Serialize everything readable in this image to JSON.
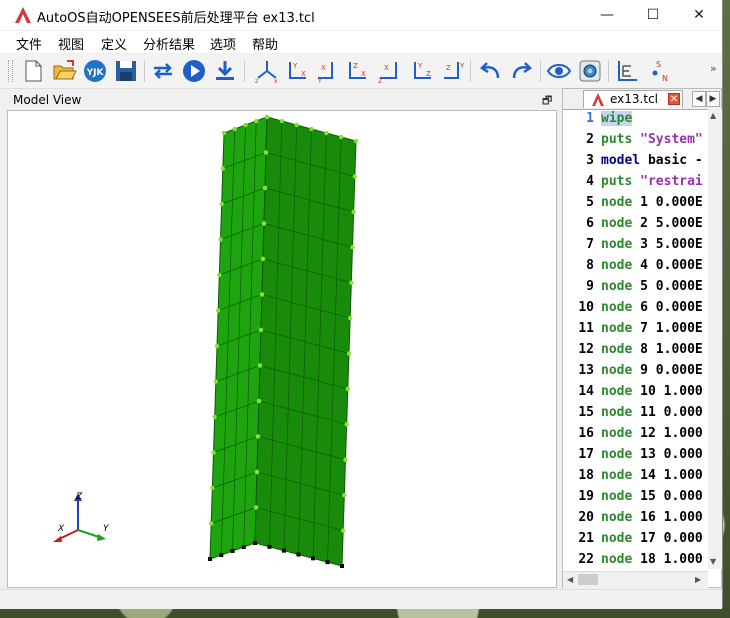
{
  "window": {
    "title": "AutoOS自动OPENSEES前后处理平台 ex13.tcl",
    "minimize": "—",
    "maximize": "☐",
    "close": "✕"
  },
  "menu": [
    {
      "label": "文件"
    },
    {
      "label": "视图"
    },
    {
      "label": "定义"
    },
    {
      "label": "分析结果"
    },
    {
      "label": "选项"
    },
    {
      "label": "帮助"
    }
  ],
  "toolbar": {
    "open_yjk_label": "YJK",
    "more_label": "»"
  },
  "model_view": {
    "title": "Model View",
    "restore": "🗗"
  },
  "axes_triad": {
    "x": "X",
    "y": "Y",
    "z": "Z"
  },
  "editor": {
    "tab_label": "ex13.tcl",
    "tab_close": "✕",
    "tab_prev": "◀",
    "tab_next": "▶",
    "scroll_up": "▲",
    "scroll_down": "▼",
    "scroll_left": "◀",
    "scroll_right": "▶",
    "lines": [
      {
        "num": "1",
        "kw": "wipe",
        "rest": ""
      },
      {
        "num": "2",
        "kw": "puts",
        "rest": " \"System\""
      },
      {
        "num": "3",
        "kw": "model",
        "rest": " basic -"
      },
      {
        "num": "4",
        "kw": "puts",
        "rest": " \"restrai"
      },
      {
        "num": "5",
        "kw": "node",
        "rest": " 1 0.000E"
      },
      {
        "num": "6",
        "kw": "node",
        "rest": " 2 5.000E"
      },
      {
        "num": "7",
        "kw": "node",
        "rest": " 3 5.000E"
      },
      {
        "num": "8",
        "kw": "node",
        "rest": " 4 0.000E"
      },
      {
        "num": "9",
        "kw": "node",
        "rest": " 5 0.000E"
      },
      {
        "num": "10",
        "kw": "node",
        "rest": " 6 0.000E"
      },
      {
        "num": "11",
        "kw": "node",
        "rest": " 7 1.000E"
      },
      {
        "num": "12",
        "kw": "node",
        "rest": " 8 1.000E"
      },
      {
        "num": "13",
        "kw": "node",
        "rest": " 9 0.000E"
      },
      {
        "num": "14",
        "kw": "node",
        "rest": " 10 1.000"
      },
      {
        "num": "15",
        "kw": "node",
        "rest": " 11 0.000"
      },
      {
        "num": "16",
        "kw": "node",
        "rest": " 12 1.000"
      },
      {
        "num": "17",
        "kw": "node",
        "rest": " 13 0.000"
      },
      {
        "num": "18",
        "kw": "node",
        "rest": " 14 1.000"
      },
      {
        "num": "19",
        "kw": "node",
        "rest": " 15 0.000"
      },
      {
        "num": "20",
        "kw": "node",
        "rest": " 16 1.000"
      },
      {
        "num": "21",
        "kw": "node",
        "rest": " 17 0.000"
      },
      {
        "num": "22",
        "kw": "node",
        "rest": " 18 1.000"
      }
    ]
  },
  "colors": {
    "mesh_green": "#1ea40e",
    "mesh_dark": "#188c0a",
    "node_point": "#7fe533",
    "base_node": "#000000",
    "keyword": "#2b8a2b",
    "string": "#9b2fb0",
    "highlight": "#c8d4f5"
  }
}
